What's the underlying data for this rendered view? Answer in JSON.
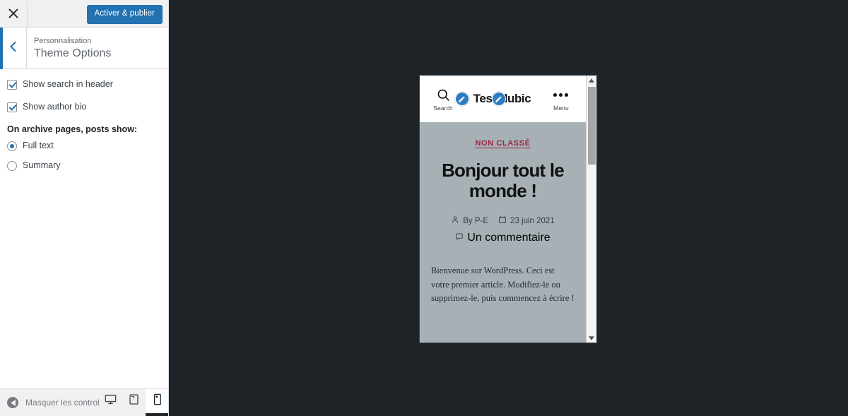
{
  "customizer": {
    "close_label": "×",
    "publish_label": "Activer & publier",
    "back_label": "‹",
    "eyebrow": "Personnalisation",
    "title": "Theme Options",
    "checkboxes": [
      {
        "label": "Show search in header",
        "checked": true
      },
      {
        "label": "Show author bio",
        "checked": true
      }
    ],
    "radio_group": {
      "label": "On archive pages, posts show:",
      "options": [
        {
          "label": "Full text",
          "checked": true
        },
        {
          "label": "Summary",
          "checked": false
        }
      ]
    },
    "footer": {
      "collapse_label": "Masquer les controles",
      "devices": [
        {
          "name": "desktop",
          "active": false
        },
        {
          "name": "tablet",
          "active": false
        },
        {
          "name": "mobile",
          "active": true
        }
      ]
    },
    "accent_color": "#2271b1"
  },
  "preview": {
    "site": {
      "header": {
        "search_caption": "Search",
        "menu_caption": "Menu",
        "title": "TestClubic",
        "edit_shortcut_count": 2
      },
      "post": {
        "category": "NON CLASSÉ",
        "title": "Bonjour tout le monde !",
        "author": "By P-E",
        "date": "23 juin 2021",
        "comments": "Un commentaire",
        "excerpt": "Bienvenue sur WordPress. Ceci est votre premier article. Modifiez-le ou supprimez-le, puis commencez à écrire !"
      },
      "background_color": "#a7b1b5",
      "category_color": "#9b2242"
    }
  }
}
